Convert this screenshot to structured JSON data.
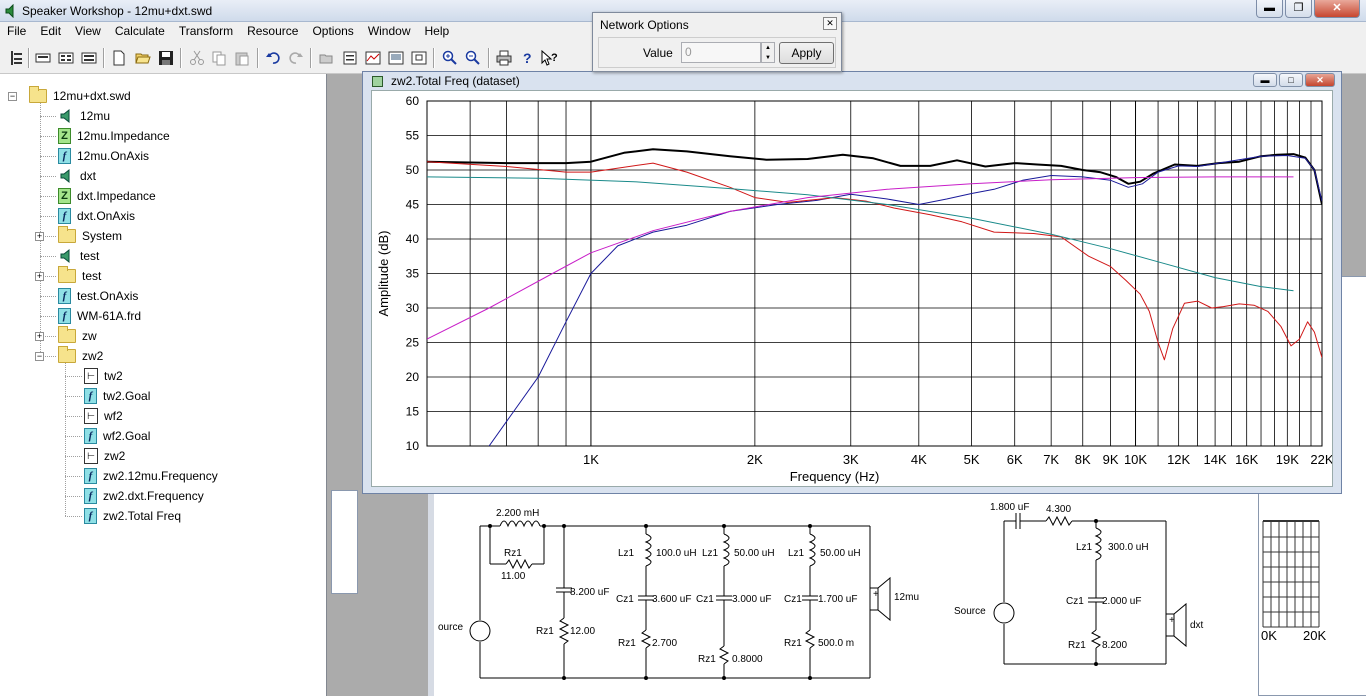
{
  "window": {
    "title": "Speaker Workshop - 12mu+dxt.swd"
  },
  "menu": [
    "File",
    "Edit",
    "View",
    "Calculate",
    "Transform",
    "Resource",
    "Options",
    "Window",
    "Help"
  ],
  "tree": {
    "root": "12mu+dxt.swd",
    "items": [
      {
        "label": "12mu",
        "icon": "speaker-icon",
        "level": 1
      },
      {
        "label": "12mu.Impedance",
        "icon": "impedance-icon",
        "level": 1
      },
      {
        "label": "12mu.OnAxis",
        "icon": "frequency-icon",
        "level": 1
      },
      {
        "label": "dxt",
        "icon": "speaker-icon",
        "level": 1
      },
      {
        "label": "dxt.Impedance",
        "icon": "impedance-icon",
        "level": 1
      },
      {
        "label": "dxt.OnAxis",
        "icon": "frequency-icon",
        "level": 1
      },
      {
        "label": "System",
        "icon": "folder-icon",
        "level": 1,
        "expander": "+"
      },
      {
        "label": "test",
        "icon": "speaker-icon",
        "level": 1
      },
      {
        "label": "test",
        "icon": "folder-icon",
        "level": 1,
        "expander": "+"
      },
      {
        "label": "test.OnAxis",
        "icon": "frequency-icon",
        "level": 1
      },
      {
        "label": "WM-61A.frd",
        "icon": "frequency-icon",
        "level": 1
      },
      {
        "label": "zw",
        "icon": "folder-icon",
        "level": 1,
        "expander": "+"
      },
      {
        "label": "zw2",
        "icon": "folder-icon",
        "level": 1,
        "expander": "-"
      },
      {
        "label": "tw2",
        "icon": "network-icon",
        "level": 2
      },
      {
        "label": "tw2.Goal",
        "icon": "frequency-icon",
        "level": 2
      },
      {
        "label": "wf2",
        "icon": "network-icon",
        "level": 2
      },
      {
        "label": "wf2.Goal",
        "icon": "frequency-icon",
        "level": 2
      },
      {
        "label": "zw2",
        "icon": "network-icon",
        "level": 2
      },
      {
        "label": "zw2.12mu.Frequency",
        "icon": "frequency-icon",
        "level": 2
      },
      {
        "label": "zw2.dxt.Frequency",
        "icon": "frequency-icon",
        "level": 2
      },
      {
        "label": "zw2.Total Freq",
        "icon": "frequency-icon",
        "level": 2
      }
    ]
  },
  "network_options": {
    "title": "Network Options",
    "value_label": "Value",
    "value": "0",
    "apply_label": "Apply"
  },
  "chart_window": {
    "title": "zw2.Total Freq (dataset)"
  },
  "colors": {
    "black": "#000000",
    "navy": "#1a1a9a",
    "red": "#d01818",
    "teal": "#1a8a8a",
    "magenta": "#c81ec8"
  },
  "chart_data": {
    "type": "line",
    "xlabel": "Frequency (Hz)",
    "ylabel": "Amplitude (dB)",
    "xscale": "log",
    "xlim": [
      500,
      22000
    ],
    "ylim": [
      10,
      60
    ],
    "ytick_labels": [
      "10",
      "15",
      "20",
      "25",
      "30",
      "35",
      "40",
      "45",
      "50",
      "55",
      "60"
    ],
    "xtick_labels": [
      {
        "label": "1K",
        "x": 1000
      },
      {
        "label": "2K",
        "x": 2000
      },
      {
        "label": "3K",
        "x": 3000
      },
      {
        "label": "4K",
        "x": 4000
      },
      {
        "label": "5K",
        "x": 5000
      },
      {
        "label": "6K",
        "x": 6000
      },
      {
        "label": "7K",
        "x": 7000
      },
      {
        "label": "8K",
        "x": 8000
      },
      {
        "label": "9K",
        "x": 9000
      },
      {
        "label": "10K",
        "x": 10000
      },
      {
        "label": "12K",
        "x": 12000
      },
      {
        "label": "14K",
        "x": 14000
      },
      {
        "label": "16K",
        "x": 16000
      },
      {
        "label": "19K",
        "x": 19000
      },
      {
        "label": "22K",
        "x": 22000
      }
    ],
    "grid": true,
    "series": [
      {
        "color": "#000000",
        "width": 2,
        "points": [
          [
            500,
            51.2
          ],
          [
            700,
            51
          ],
          [
            900,
            51
          ],
          [
            1000,
            51.2
          ],
          [
            1150,
            52.5
          ],
          [
            1300,
            53
          ],
          [
            1500,
            52.7
          ],
          [
            1800,
            52
          ],
          [
            2100,
            51.5
          ],
          [
            2500,
            51.6
          ],
          [
            2900,
            52.2
          ],
          [
            3300,
            51.7
          ],
          [
            3700,
            50.6
          ],
          [
            4200,
            50.6
          ],
          [
            4700,
            51.4
          ],
          [
            5300,
            50.5
          ],
          [
            6000,
            51
          ],
          [
            6600,
            50.8
          ],
          [
            7300,
            50.6
          ],
          [
            8000,
            50
          ],
          [
            8600,
            49.7
          ],
          [
            9200,
            49
          ],
          [
            9700,
            48
          ],
          [
            10200,
            48.3
          ],
          [
            10800,
            49.5
          ],
          [
            11800,
            50.8
          ],
          [
            13000,
            50.6
          ],
          [
            14200,
            51
          ],
          [
            15500,
            51.2
          ],
          [
            17000,
            52
          ],
          [
            18200,
            52.2
          ],
          [
            19500,
            52.3
          ],
          [
            20500,
            51.8
          ],
          [
            21300,
            50
          ],
          [
            22000,
            45
          ]
        ]
      },
      {
        "color": "#1a1a9a",
        "width": 1,
        "points": [
          [
            650,
            10
          ],
          [
            800,
            20
          ],
          [
            900,
            28
          ],
          [
            1000,
            35
          ],
          [
            1120,
            39
          ],
          [
            1300,
            41
          ],
          [
            1500,
            42
          ],
          [
            1800,
            44
          ],
          [
            2200,
            45
          ],
          [
            2600,
            45.6
          ],
          [
            3000,
            46.5
          ],
          [
            3500,
            45.8
          ],
          [
            4000,
            45
          ],
          [
            4500,
            45.8
          ],
          [
            5000,
            46.6
          ],
          [
            5500,
            47.2
          ],
          [
            6200,
            48.5
          ],
          [
            7000,
            49.2
          ],
          [
            8000,
            49
          ],
          [
            9000,
            48.5
          ],
          [
            9700,
            47.5
          ],
          [
            10300,
            48
          ],
          [
            11000,
            49.7
          ],
          [
            12000,
            50.6
          ],
          [
            13000,
            50.5
          ],
          [
            15000,
            51.3
          ],
          [
            17000,
            52
          ],
          [
            19000,
            52.1
          ],
          [
            20500,
            51.7
          ],
          [
            21300,
            50
          ],
          [
            22000,
            45.5
          ]
        ]
      },
      {
        "color": "#d01818",
        "width": 1,
        "points": [
          [
            500,
            51.2
          ],
          [
            700,
            50.5
          ],
          [
            900,
            49.7
          ],
          [
            1000,
            49.7
          ],
          [
            1150,
            50.4
          ],
          [
            1300,
            51
          ],
          [
            1500,
            49.7
          ],
          [
            1800,
            47.5
          ],
          [
            2000,
            46
          ],
          [
            2300,
            45.3
          ],
          [
            2800,
            46
          ],
          [
            3200,
            45.5
          ],
          [
            3600,
            44.5
          ],
          [
            4200,
            43.5
          ],
          [
            4800,
            42.5
          ],
          [
            5500,
            41
          ],
          [
            6500,
            40.8
          ],
          [
            7300,
            40.3
          ],
          [
            8200,
            37.5
          ],
          [
            9000,
            36
          ],
          [
            9600,
            34
          ],
          [
            10200,
            32
          ],
          [
            10600,
            29.5
          ],
          [
            11000,
            25
          ],
          [
            11300,
            22.5
          ],
          [
            11700,
            27
          ],
          [
            12300,
            30.7
          ],
          [
            13000,
            31
          ],
          [
            13800,
            30
          ],
          [
            14500,
            30.2
          ],
          [
            15500,
            30.6
          ],
          [
            16500,
            30.4
          ],
          [
            17500,
            29.5
          ],
          [
            18500,
            27.3
          ],
          [
            19300,
            24.5
          ],
          [
            20000,
            25.5
          ],
          [
            20700,
            28
          ],
          [
            21300,
            26.5
          ],
          [
            22000,
            22.8
          ]
        ]
      },
      {
        "color": "#1a8a8a",
        "width": 1,
        "points": [
          [
            500,
            49
          ],
          [
            800,
            48.8
          ],
          [
            1200,
            48.3
          ],
          [
            1800,
            47.3
          ],
          [
            2500,
            46.4
          ],
          [
            3500,
            45
          ],
          [
            5000,
            43
          ],
          [
            7000,
            40.7
          ],
          [
            9000,
            38.6
          ],
          [
            11000,
            36.7
          ],
          [
            14000,
            34.4
          ],
          [
            17000,
            33.1
          ],
          [
            19500,
            32.5
          ]
        ]
      },
      {
        "color": "#c81ec8",
        "width": 1,
        "points": [
          [
            500,
            25.5
          ],
          [
            650,
            30
          ],
          [
            850,
            35
          ],
          [
            1000,
            38
          ],
          [
            1300,
            41.2
          ],
          [
            1800,
            44
          ],
          [
            2500,
            46
          ],
          [
            3500,
            47.2
          ],
          [
            5000,
            48
          ],
          [
            7000,
            48.6
          ],
          [
            10000,
            48.9
          ],
          [
            14000,
            49
          ],
          [
            19500,
            49
          ]
        ]
      }
    ]
  },
  "circuits": {
    "left": {
      "L1": "2.200 mH",
      "Rz1a": "Rz1",
      "Rz1a_val": "11.00",
      "C1": "8.200 uF",
      "R2": "Rz1",
      "R2_val": "12.00",
      "Lz1a": "Lz1",
      "Lz1a_val": "100.0 uH",
      "Cz1a": "Cz1",
      "Cz1a_val": "3.600 uF",
      "Rz1b": "Rz1",
      "Rz1b_val": "2.700",
      "Lz1b": "Lz1",
      "Lz1b_val": "50.00 uH",
      "Cz1b": "Cz1",
      "Cz1b_val": "3.000 uF",
      "Rz1c": "Rz1",
      "Rz1c_val": "0.8000",
      "Lz1c": "Lz1",
      "Lz1c_val": "50.00 uH",
      "Cz1c": "Cz1",
      "Cz1c_val": "1.700 uF",
      "Rz1d": "Rz1",
      "Rz1d_val": "500.0 m",
      "source": "ource",
      "driver": "12mu"
    },
    "right": {
      "C1": "1.800 uF",
      "R1": "4.300",
      "Lz1": "Lz1",
      "Lz1_val": "300.0 uH",
      "Cz1": "Cz1",
      "Cz1_val": "2.000 uF",
      "Rz1": "Rz1",
      "Rz1_val": "8.200",
      "source": "Source",
      "driver": "dxt"
    }
  },
  "right_window": {
    "labels": [
      "0K",
      "20K"
    ]
  }
}
